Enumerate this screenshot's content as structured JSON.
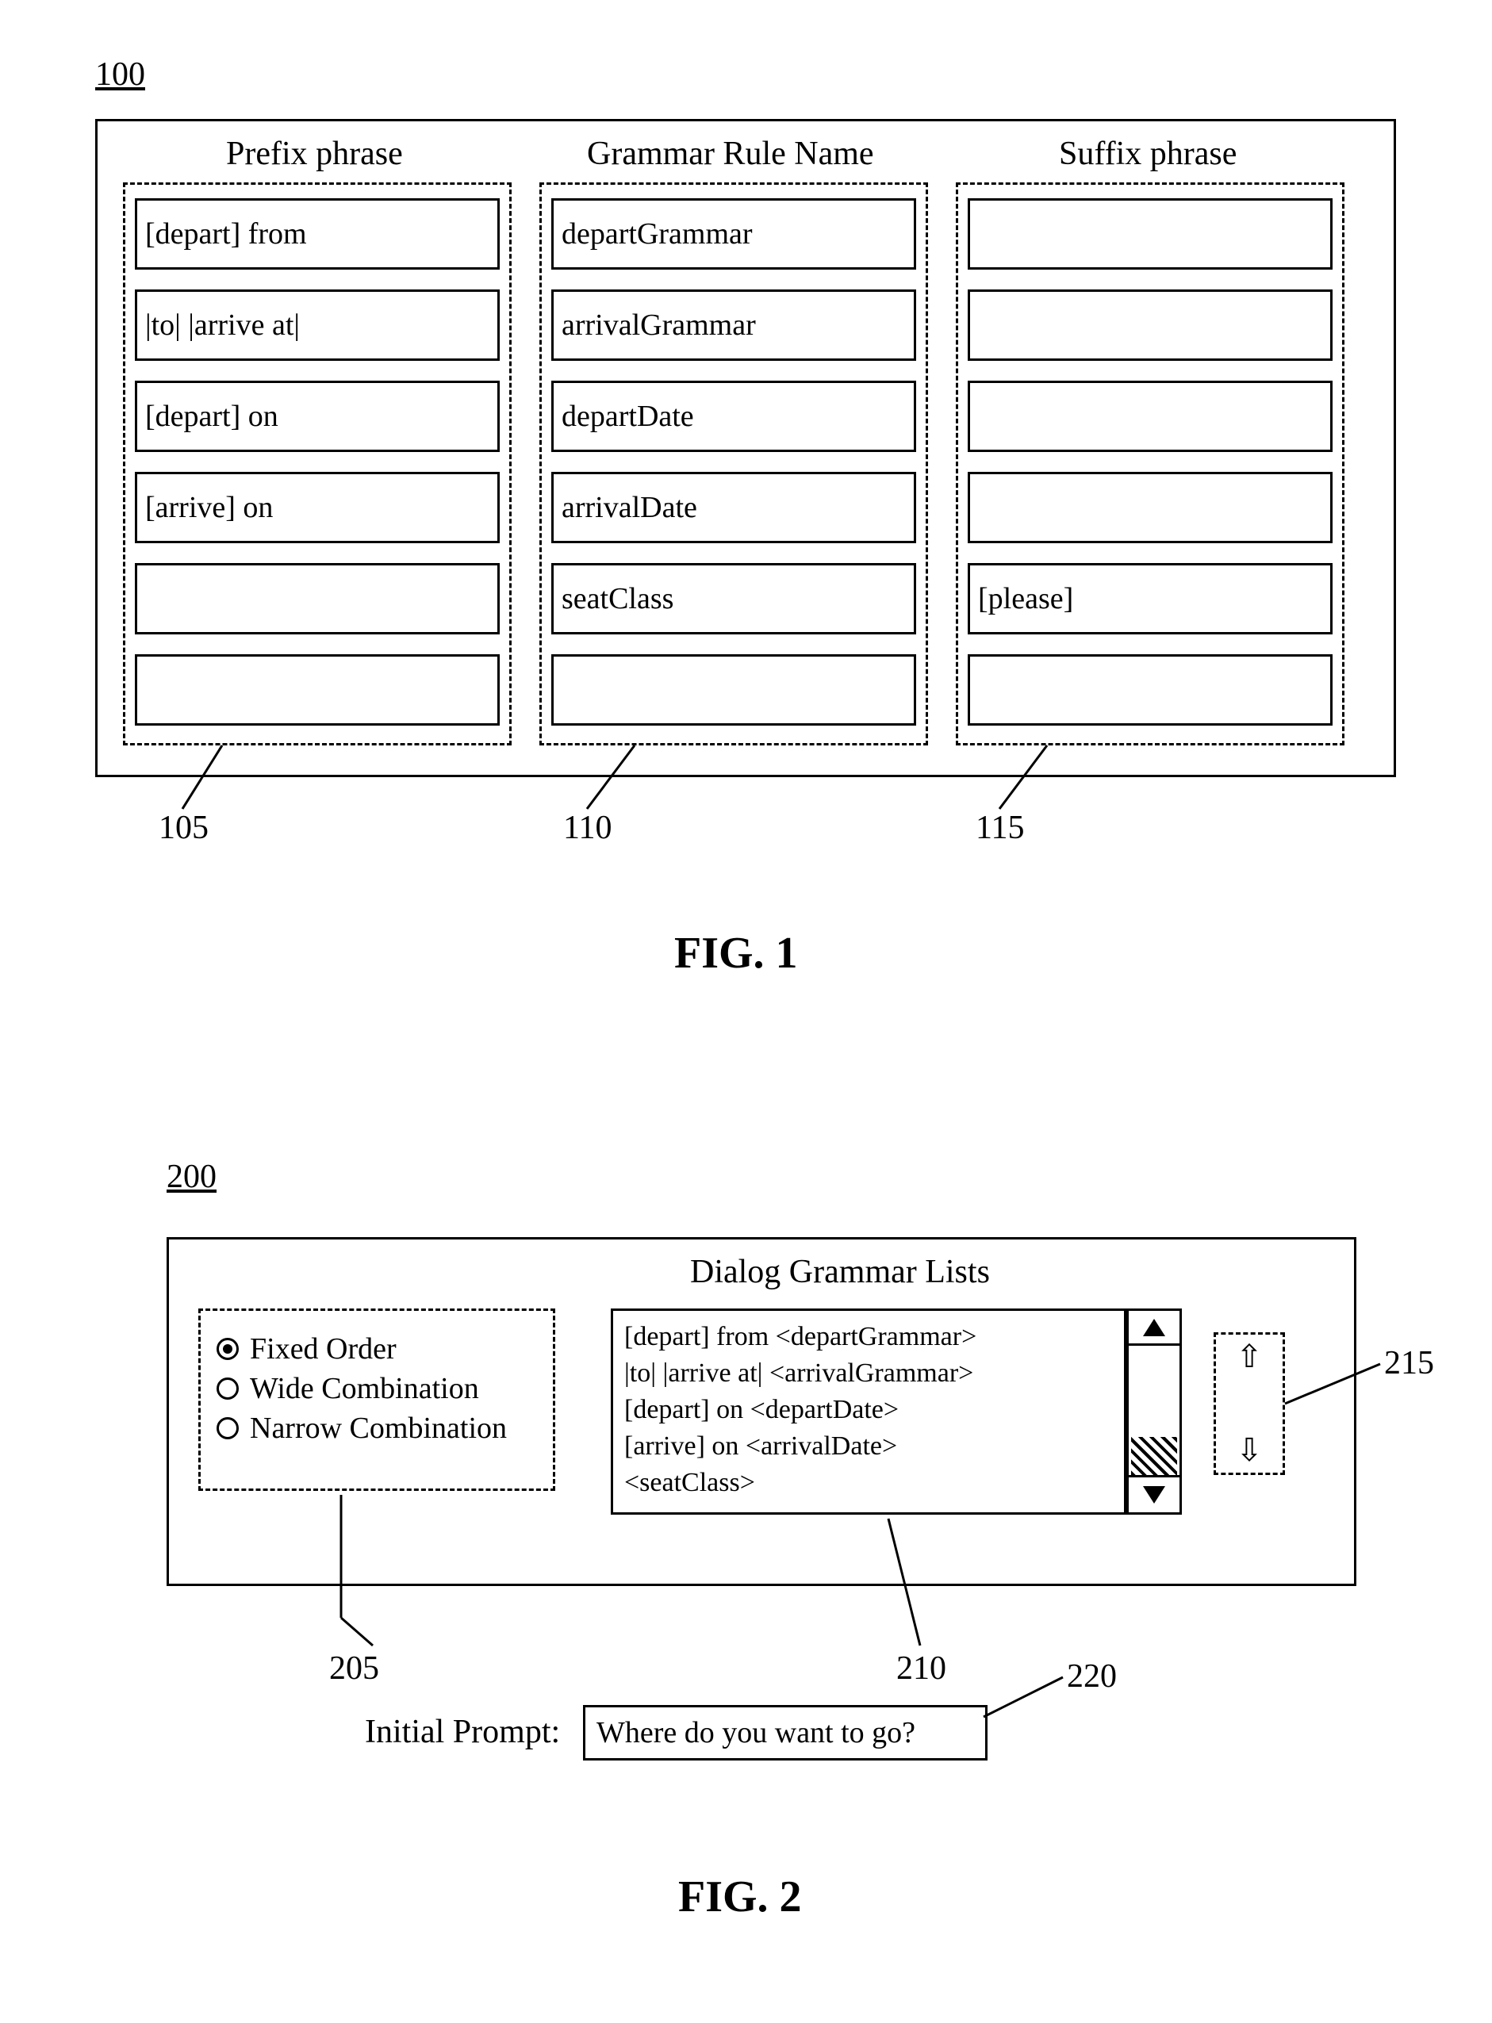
{
  "fig1": {
    "ref": "100",
    "caption": "FIG. 1",
    "headers": {
      "prefix": "Prefix phrase",
      "grammar": "Grammar Rule Name",
      "suffix": "Suffix phrase"
    },
    "rows": [
      {
        "prefix": "[depart] from",
        "grammar": "departGrammar",
        "suffix": ""
      },
      {
        "prefix": "|to| |arrive at|",
        "grammar": "arrivalGrammar",
        "suffix": ""
      },
      {
        "prefix": "[depart] on",
        "grammar": "departDate",
        "suffix": ""
      },
      {
        "prefix": "[arrive] on",
        "grammar": "arrivalDate",
        "suffix": ""
      },
      {
        "prefix": "",
        "grammar": "seatClass",
        "suffix": "[please]"
      },
      {
        "prefix": "",
        "grammar": "",
        "suffix": ""
      }
    ],
    "callouts": {
      "prefix": "105",
      "grammar": "110",
      "suffix": "115"
    }
  },
  "fig2": {
    "ref": "200",
    "caption": "FIG. 2",
    "title": "Dialog Grammar Lists",
    "options": [
      {
        "label": "Fixed Order",
        "checked": true
      },
      {
        "label": "Wide Combination",
        "checked": false
      },
      {
        "label": "Narrow Combination",
        "checked": false
      }
    ],
    "list_items": [
      "[depart] from <departGrammar>",
      "|to| |arrive at| <arrivalGrammar>",
      "[depart] on <departDate>",
      "[arrive] on <arrivalDate>",
      "<seatClass>"
    ],
    "prompt_label": "Initial Prompt:",
    "prompt_value": "Where do you want to go?",
    "callouts": {
      "options": "205",
      "list": "210",
      "reorder": "215",
      "prompt": "220"
    }
  }
}
